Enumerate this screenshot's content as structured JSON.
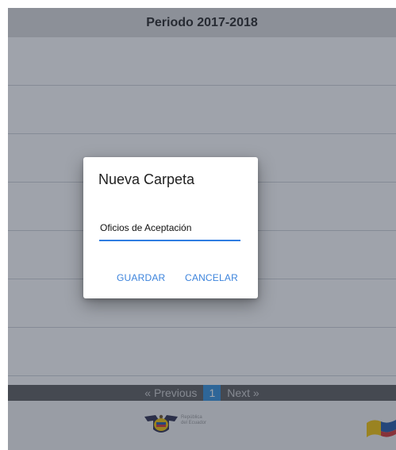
{
  "header": {
    "title": "Periodo 2017-2018"
  },
  "pagination": {
    "previous_label": "« Previous",
    "current_page": "1",
    "next_label": "Next »"
  },
  "footer": {
    "logo_text_line1": "República",
    "logo_text_line2": "del Ecuador"
  },
  "dialog": {
    "title": "Nueva Carpeta",
    "folder_name_value": "Oficios de Aceptación",
    "save_label": "GUARDAR",
    "cancel_label": "CANCELAR"
  },
  "colors": {
    "accent": "#2f7de1",
    "pagination_active": "#2f8fdc",
    "overlay": "rgba(45, 55, 72, 0.46)"
  }
}
